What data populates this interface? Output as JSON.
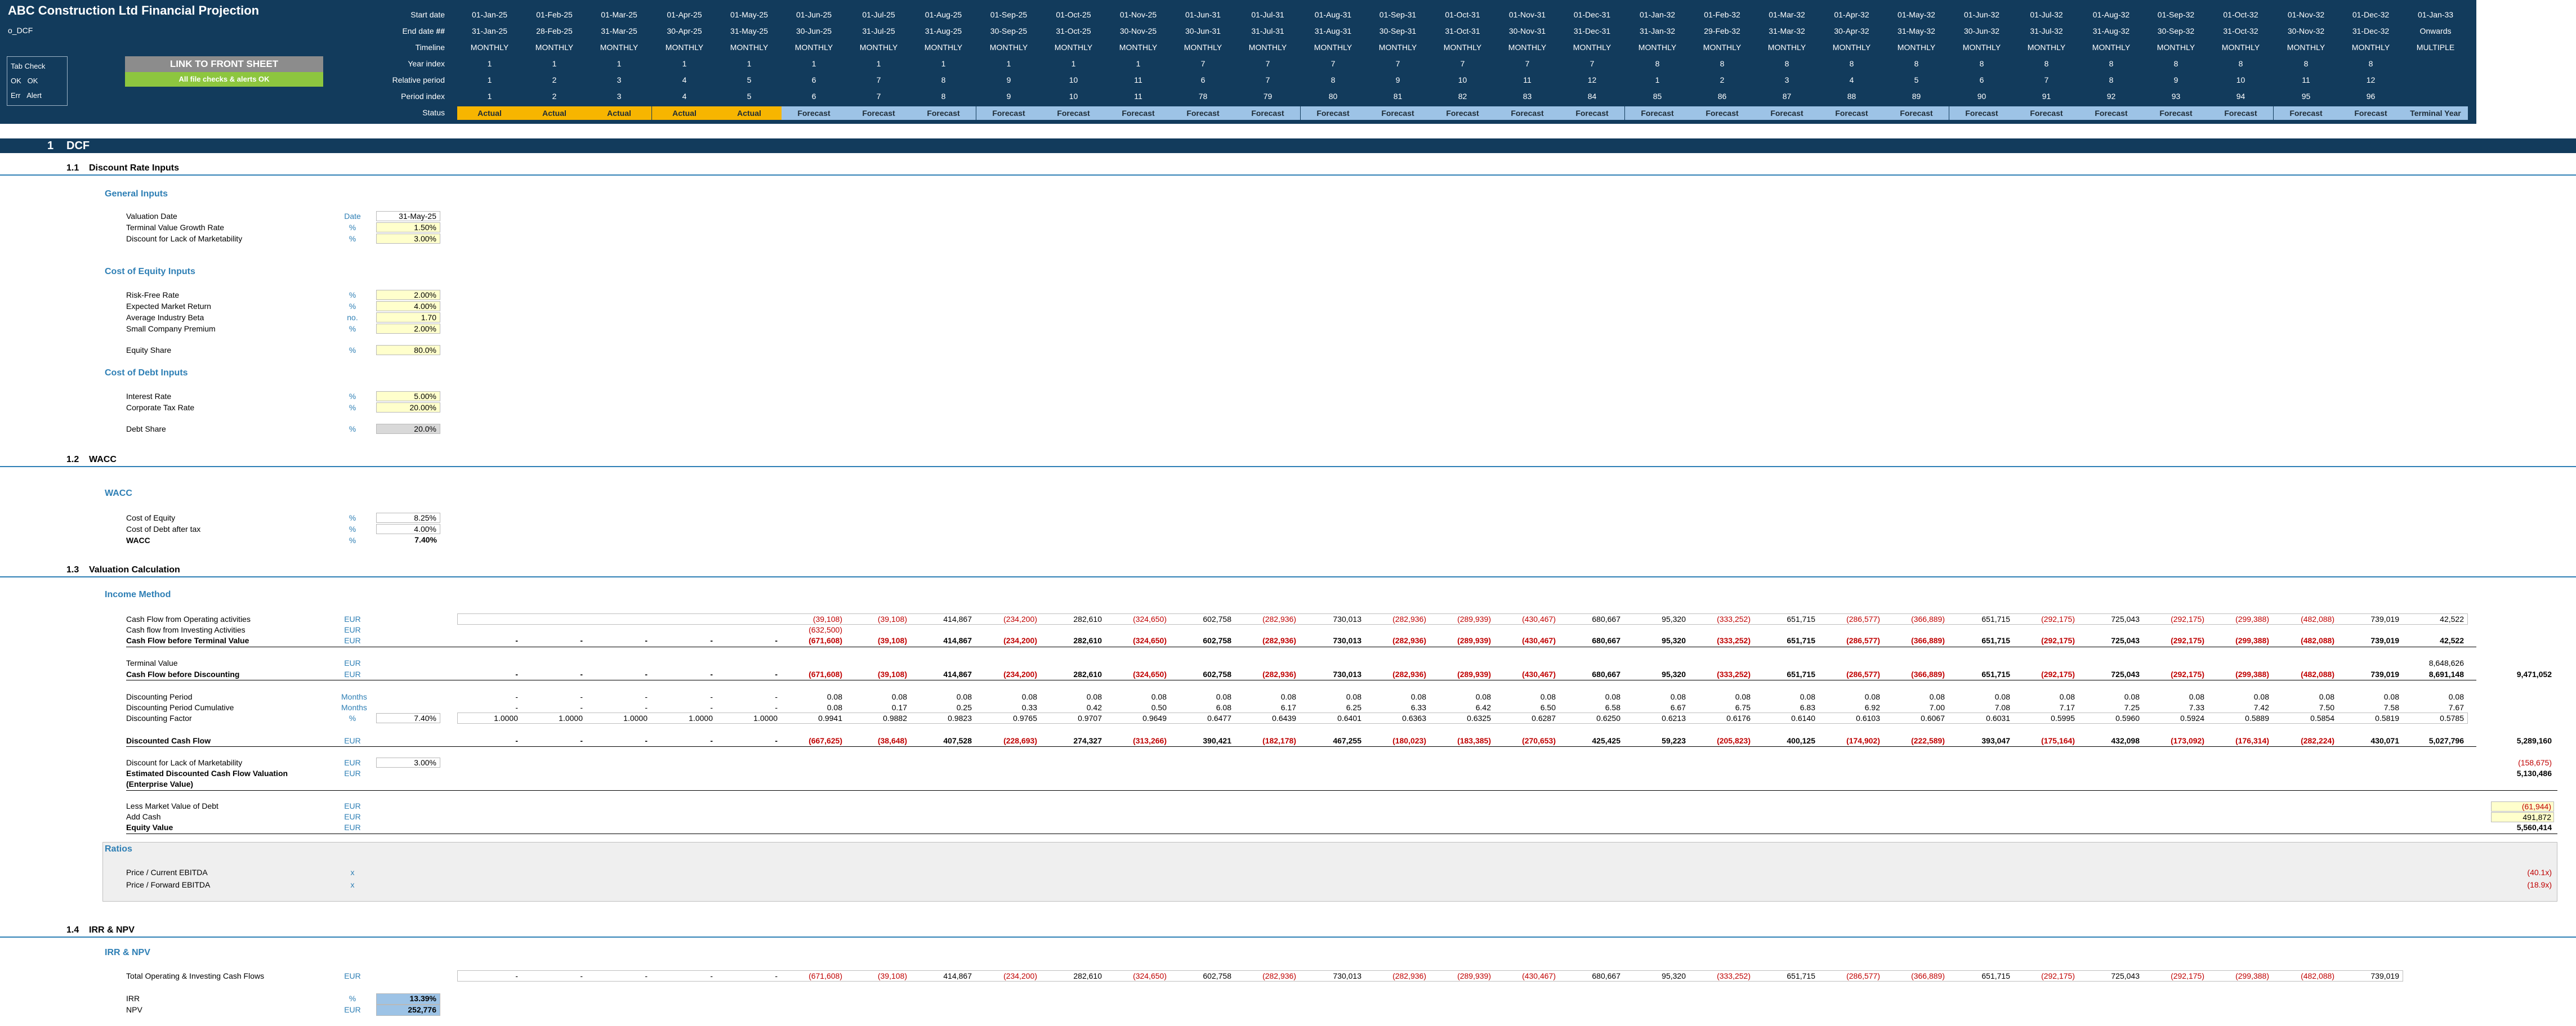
{
  "app": {
    "title": "ABC Construction Ltd Financial Projection",
    "sheet": "o_DCF",
    "tab_check_label": "Tab Check",
    "ok_label": "OK",
    "ok_value": "OK",
    "err_label": "Err",
    "alert_label": "Alert",
    "link_button": "LINK TO FRONT SHEET",
    "checks_ok": "All file checks & alerts OK",
    "colors": {
      "header": "#123B5C",
      "actual": "#F7B500",
      "forecast": "#9DC3E6",
      "accent": "#2E7FB5",
      "negative": "#C00000",
      "ok": "#8DC63F"
    }
  },
  "timeline": {
    "labels": {
      "start": "Start date",
      "end": "End date",
      "end_flag": "##",
      "timeline": "Timeline",
      "year_index": "Year index",
      "relative_period": "Relative period",
      "period_index": "Period index",
      "status": "Status"
    },
    "start_dates": [
      "01-Jan-25",
      "01-Feb-25",
      "01-Mar-25",
      "01-Apr-25",
      "01-May-25",
      "01-Jun-25",
      "01-Jul-25",
      "01-Aug-25",
      "01-Sep-25",
      "01-Oct-25",
      "01-Nov-25",
      "01-Jun-31",
      "01-Jul-31",
      "01-Aug-31",
      "01-Sep-31",
      "01-Oct-31",
      "01-Nov-31",
      "01-Dec-31",
      "01-Jan-32",
      "01-Feb-32",
      "01-Mar-32",
      "01-Apr-32",
      "01-May-32",
      "01-Jun-32",
      "01-Jul-32",
      "01-Aug-32",
      "01-Sep-32",
      "01-Oct-32",
      "01-Nov-32",
      "01-Dec-32",
      "01-Jan-33"
    ],
    "end_dates": [
      "31-Jan-25",
      "28-Feb-25",
      "31-Mar-25",
      "30-Apr-25",
      "31-May-25",
      "30-Jun-25",
      "31-Jul-25",
      "31-Aug-25",
      "30-Sep-25",
      "31-Oct-25",
      "30-Nov-25",
      "30-Jun-31",
      "31-Jul-31",
      "31-Aug-31",
      "30-Sep-31",
      "31-Oct-31",
      "30-Nov-31",
      "31-Dec-31",
      "31-Jan-32",
      "29-Feb-32",
      "31-Mar-32",
      "30-Apr-32",
      "31-May-32",
      "30-Jun-32",
      "31-Jul-32",
      "31-Aug-32",
      "30-Sep-32",
      "31-Oct-32",
      "30-Nov-32",
      "31-Dec-32",
      "Onwards"
    ],
    "timeline": [
      "MONTHLY",
      "MONTHLY",
      "MONTHLY",
      "MONTHLY",
      "MONTHLY",
      "MONTHLY",
      "MONTHLY",
      "MONTHLY",
      "MONTHLY",
      "MONTHLY",
      "MONTHLY",
      "MONTHLY",
      "MONTHLY",
      "MONTHLY",
      "MONTHLY",
      "MONTHLY",
      "MONTHLY",
      "MONTHLY",
      "MONTHLY",
      "MONTHLY",
      "MONTHLY",
      "MONTHLY",
      "MONTHLY",
      "MONTHLY",
      "MONTHLY",
      "MONTHLY",
      "MONTHLY",
      "MONTHLY",
      "MONTHLY",
      "MONTHLY",
      "MULTIPLE"
    ],
    "year_index": [
      "1",
      "1",
      "1",
      "1",
      "1",
      "1",
      "1",
      "1",
      "1",
      "1",
      "1",
      "7",
      "7",
      "7",
      "7",
      "7",
      "7",
      "7",
      "8",
      "8",
      "8",
      "8",
      "8",
      "8",
      "8",
      "8",
      "8",
      "8",
      "8",
      "8",
      ""
    ],
    "relative_period": [
      "1",
      "2",
      "3",
      "4",
      "5",
      "6",
      "7",
      "8",
      "9",
      "10",
      "11",
      "6",
      "7",
      "8",
      "9",
      "10",
      "11",
      "12",
      "1",
      "2",
      "3",
      "4",
      "5",
      "6",
      "7",
      "8",
      "9",
      "10",
      "11",
      "12",
      ""
    ],
    "period_index": [
      "1",
      "2",
      "3",
      "4",
      "5",
      "6",
      "7",
      "8",
      "9",
      "10",
      "11",
      "78",
      "79",
      "80",
      "81",
      "82",
      "83",
      "84",
      "85",
      "86",
      "87",
      "88",
      "89",
      "90",
      "91",
      "92",
      "93",
      "94",
      "95",
      "96",
      ""
    ],
    "status": [
      "Actual",
      "Actual",
      "Actual",
      "Actual",
      "Actual",
      "Forecast",
      "Forecast",
      "Forecast",
      "Forecast",
      "Forecast",
      "Forecast",
      "Forecast",
      "Forecast",
      "Forecast",
      "Forecast",
      "Forecast",
      "Forecast",
      "Forecast",
      "Forecast",
      "Forecast",
      "Forecast",
      "Forecast",
      "Forecast",
      "Forecast",
      "Forecast",
      "Forecast",
      "Forecast",
      "Forecast",
      "Forecast",
      "Forecast",
      "Terminal Year"
    ]
  },
  "section1": {
    "num": "1",
    "title": "DCF"
  },
  "s11": {
    "num": "1.1",
    "title": "Discount Rate Inputs",
    "general_title": "General Inputs",
    "general": [
      {
        "label": "Valuation Date",
        "unit": "Date",
        "value": "31-May-25"
      },
      {
        "label": "Terminal Value Growth Rate",
        "unit": "%",
        "value": "1.50%"
      },
      {
        "label": "Discount for Lack of Marketability",
        "unit": "%",
        "value": "3.00%"
      }
    ],
    "coe_title": "Cost of Equity Inputs",
    "coe": [
      {
        "label": "Risk-Free Rate",
        "unit": "%",
        "value": "2.00%"
      },
      {
        "label": "Expected Market Return",
        "unit": "%",
        "value": "4.00%"
      },
      {
        "label": "Average Industry Beta",
        "unit": "no.",
        "value": "1.70"
      },
      {
        "label": "Small Company Premium",
        "unit": "%",
        "value": "2.00%"
      }
    ],
    "equity_share": {
      "label": "Equity Share",
      "unit": "%",
      "value": "80.0%"
    },
    "cod_title": "Cost of Debt Inputs",
    "cod": [
      {
        "label": "Interest Rate",
        "unit": "%",
        "value": "5.00%"
      },
      {
        "label": "Corporate Tax Rate",
        "unit": "%",
        "value": "20.00%"
      }
    ],
    "debt_share": {
      "label": "Debt Share",
      "unit": "%",
      "value": "20.0%"
    }
  },
  "s12": {
    "num": "1.2",
    "title": "WACC",
    "sub": "WACC",
    "rows": [
      {
        "label": "Cost of Equity",
        "unit": "%",
        "value": "8.25%"
      },
      {
        "label": "Cost of Debt after tax",
        "unit": "%",
        "value": "4.00%"
      },
      {
        "label": "WACC",
        "unit": "%",
        "value": "7.40%"
      }
    ]
  },
  "s13": {
    "num": "1.3",
    "title": "Valuation Calculation",
    "sub": "Income Method",
    "rows": [
      {
        "label": "Cash Flow from Operating activities",
        "unit": "EUR",
        "vals": [
          "",
          "",
          "",
          "",
          "",
          "(39,108)",
          "(39,108)",
          "414,867",
          "(234,200)",
          "282,610",
          "(324,650)",
          "602,758",
          "(282,936)",
          "730,013",
          "(282,936)",
          "(289,939)",
          "(430,467)",
          "680,667",
          "95,320",
          "(333,252)",
          "651,715",
          "(286,577)",
          "(366,889)",
          "651,715",
          "(292,175)",
          "725,043",
          "(292,175)",
          "(299,388)",
          "(482,088)",
          "739,019",
          "42,522"
        ],
        "extra": ""
      },
      {
        "label": "Cash flow from Investing Activities",
        "unit": "EUR",
        "vals": [
          "",
          "",
          "",
          "",
          "",
          "(632,500)",
          "",
          "",
          "",
          "",
          "",
          "",
          "",
          "",
          "",
          "",
          "",
          "",
          "",
          "",
          "",
          "",
          "",
          "",
          "",
          "",
          "",
          "",
          "",
          "",
          ""
        ],
        "extra": ""
      },
      {
        "label": "Cash Flow before Terminal Value",
        "unit": "EUR",
        "bold": true,
        "vals": [
          "-",
          "-",
          "-",
          "-",
          "-",
          "(671,608)",
          "(39,108)",
          "414,867",
          "(234,200)",
          "282,610",
          "(324,650)",
          "602,758",
          "(282,936)",
          "730,013",
          "(282,936)",
          "(289,939)",
          "(430,467)",
          "680,667",
          "95,320",
          "(333,252)",
          "651,715",
          "(286,577)",
          "(366,889)",
          "651,715",
          "(292,175)",
          "725,043",
          "(292,175)",
          "(299,388)",
          "(482,088)",
          "739,019",
          "42,522"
        ],
        "extra": ""
      },
      {
        "label": "Terminal Value",
        "unit": "EUR",
        "vals": [
          "",
          "",
          "",
          "",
          "",
          "",
          "",
          "",
          "",
          "",
          "",
          "",
          "",
          "",
          "",
          "",
          "",
          "",
          "",
          "",
          "",
          "",
          "",
          "",
          "",
          "",
          "",
          "",
          "",
          "",
          "8,648,626"
        ],
        "extra": ""
      },
      {
        "label": "Cash Flow before Discounting",
        "unit": "EUR",
        "bold": true,
        "vals": [
          "-",
          "-",
          "-",
          "-",
          "-",
          "(671,608)",
          "(39,108)",
          "414,867",
          "(234,200)",
          "282,610",
          "(324,650)",
          "602,758",
          "(282,936)",
          "730,013",
          "(282,936)",
          "(289,939)",
          "(430,467)",
          "680,667",
          "95,320",
          "(333,252)",
          "651,715",
          "(286,577)",
          "(366,889)",
          "651,715",
          "(292,175)",
          "725,043",
          "(292,175)",
          "(299,388)",
          "(482,088)",
          "739,019",
          "8,691,148"
        ],
        "extra": "9,471,052"
      },
      {
        "label": "Discounting Period",
        "unit": "Months",
        "vals": [
          "-",
          "-",
          "-",
          "-",
          "-",
          "0.08",
          "0.08",
          "0.08",
          "0.08",
          "0.08",
          "0.08",
          "0.08",
          "0.08",
          "0.08",
          "0.08",
          "0.08",
          "0.08",
          "0.08",
          "0.08",
          "0.08",
          "0.08",
          "0.08",
          "0.08",
          "0.08",
          "0.08",
          "0.08",
          "0.08",
          "0.08",
          "0.08",
          "0.08",
          "0.08"
        ],
        "extra": ""
      },
      {
        "label": "Discounting Period Cumulative",
        "unit": "Months",
        "vals": [
          "-",
          "-",
          "-",
          "-",
          "-",
          "0.08",
          "0.17",
          "0.25",
          "0.33",
          "0.42",
          "0.50",
          "6.08",
          "6.17",
          "6.25",
          "6.33",
          "6.42",
          "6.50",
          "6.58",
          "6.67",
          "6.75",
          "6.83",
          "6.92",
          "7.00",
          "7.08",
          "7.17",
          "7.25",
          "7.33",
          "7.42",
          "7.50",
          "7.58",
          "7.67"
        ],
        "extra": ""
      },
      {
        "label": "Discounting Factor",
        "unit": "%",
        "input": "7.40%",
        "vals": [
          "1.0000",
          "1.0000",
          "1.0000",
          "1.0000",
          "1.0000",
          "0.9941",
          "0.9882",
          "0.9823",
          "0.9765",
          "0.9707",
          "0.9649",
          "0.6477",
          "0.6439",
          "0.6401",
          "0.6363",
          "0.6325",
          "0.6287",
          "0.6250",
          "0.6213",
          "0.6176",
          "0.6140",
          "0.6103",
          "0.6067",
          "0.6031",
          "0.5995",
          "0.5960",
          "0.5924",
          "0.5889",
          "0.5854",
          "0.5819",
          "0.5785"
        ],
        "extra": ""
      },
      {
        "label": "Discounted Cash Flow",
        "unit": "EUR",
        "bold": true,
        "vals": [
          "-",
          "-",
          "-",
          "-",
          "-",
          "(667,625)",
          "(38,648)",
          "407,528",
          "(228,693)",
          "274,327",
          "(313,266)",
          "390,421",
          "(182,178)",
          "467,255",
          "(180,023)",
          "(183,385)",
          "(270,653)",
          "425,425",
          "59,223",
          "(205,823)",
          "400,125",
          "(174,902)",
          "(222,589)",
          "393,047",
          "(175,164)",
          "432,098",
          "(173,092)",
          "(176,314)",
          "(282,224)",
          "430,071",
          "5,027,796"
        ],
        "extra": "5,289,160"
      },
      {
        "label": "Discount for Lack of Marketability",
        "unit": "EUR",
        "input": "3.00%",
        "vals": [],
        "extra": "(158,675)"
      },
      {
        "label": "Estimated Discounted Cash Flow Valuation",
        "unit": "EUR",
        "bold": true,
        "vals": [],
        "extra": "5,130,486"
      },
      {
        "label": "(Enterprise Value)",
        "unit": "",
        "bold": true,
        "vals": [],
        "extra": ""
      },
      {
        "label": "Less Market Value of Debt",
        "unit": "EUR",
        "vals": [],
        "extra": "(61,944)"
      },
      {
        "label": "Add Cash",
        "unit": "EUR",
        "vals": [],
        "extra": "491,872"
      },
      {
        "label": "Equity Value",
        "unit": "EUR",
        "bold": true,
        "vals": [],
        "extra": "5,560,414"
      }
    ],
    "ratios_title": "Ratios",
    "ratios": [
      {
        "label": "Price / Current EBITDA",
        "unit": "x",
        "value": "(40.1x)"
      },
      {
        "label": "Price / Forward EBITDA",
        "unit": "x",
        "value": "(18.9x)"
      }
    ]
  },
  "s14": {
    "num": "1.4",
    "title": "IRR & NPV",
    "sub": "IRR & NPV",
    "total": {
      "label": "Total Operating & Investing Cash Flows",
      "unit": "EUR",
      "vals": [
        "-",
        "-",
        "-",
        "-",
        "-",
        "(671,608)",
        "(39,108)",
        "414,867",
        "(234,200)",
        "282,610",
        "(324,650)",
        "602,758",
        "(282,936)",
        "730,013",
        "(282,936)",
        "(289,939)",
        "(430,467)",
        "680,667",
        "95,320",
        "(333,252)",
        "651,715",
        "(286,577)",
        "(366,889)",
        "651,715",
        "(292,175)",
        "725,043",
        "(292,175)",
        "(299,388)",
        "(482,088)",
        "739,019",
        ""
      ]
    },
    "irr": {
      "label": "IRR",
      "unit": "%",
      "value": "13.39%"
    },
    "npv": {
      "label": "NPV",
      "unit": "EUR",
      "value": "252,776"
    }
  }
}
